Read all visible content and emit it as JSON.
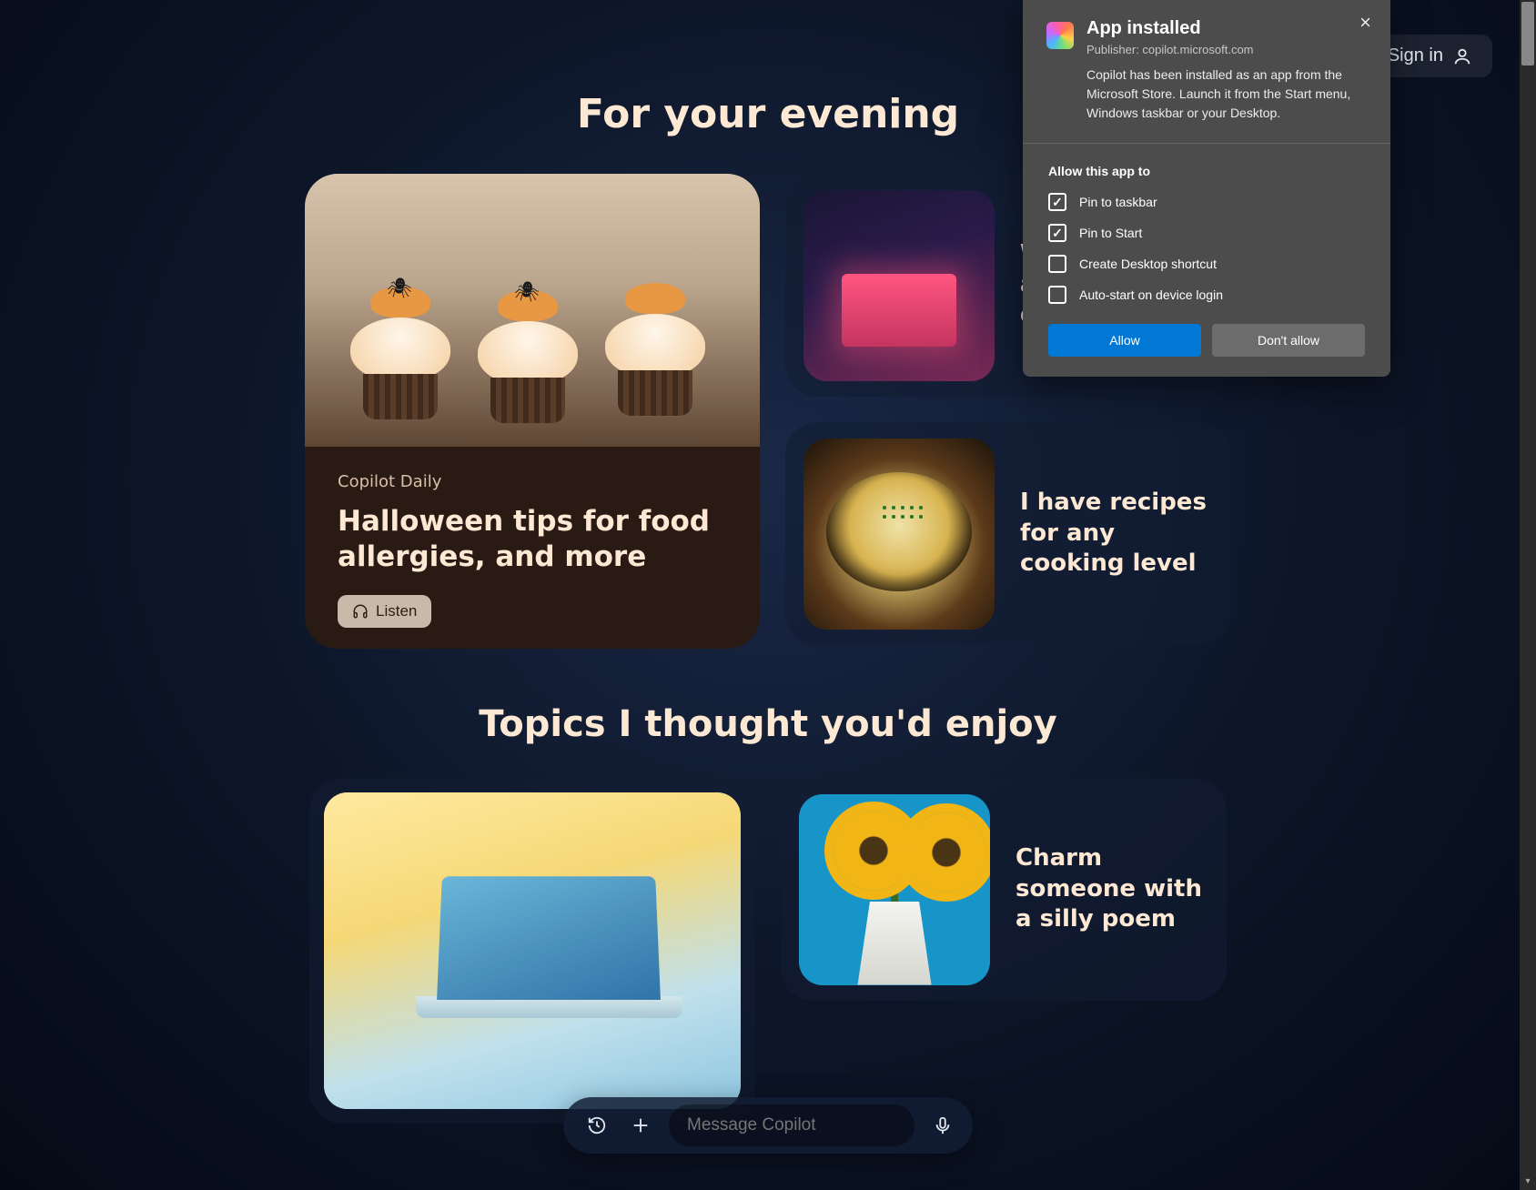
{
  "header": {
    "sign_in": "Sign in"
  },
  "sections": {
    "evening_title": "For your evening",
    "topics_title": "Topics I thought you'd enjoy"
  },
  "featured_card": {
    "eyebrow": "Copilot Daily",
    "title": "Halloween tips for food allergies, and more",
    "listen_label": "Listen"
  },
  "small_cards": {
    "card1_label": "Wind down after a long day",
    "card2_label": "I have recipes for any cooking level"
  },
  "topic_cards": {
    "card1_label": "Charm someone with a silly poem"
  },
  "compose": {
    "placeholder": "Message Copilot"
  },
  "install_modal": {
    "title": "App installed",
    "publisher": "Publisher: copilot.microsoft.com",
    "description": "Copilot has been installed as an app from the Microsoft Store. Launch it from the Start menu, Windows taskbar or your Desktop.",
    "permissions_title": "Allow this app to",
    "perm_pin_taskbar": "Pin to taskbar",
    "perm_pin_start": "Pin to Start",
    "perm_desktop_shortcut": "Create Desktop shortcut",
    "perm_autostart": "Auto-start on device login",
    "allow_btn": "Allow",
    "dont_allow_btn": "Don't allow"
  }
}
